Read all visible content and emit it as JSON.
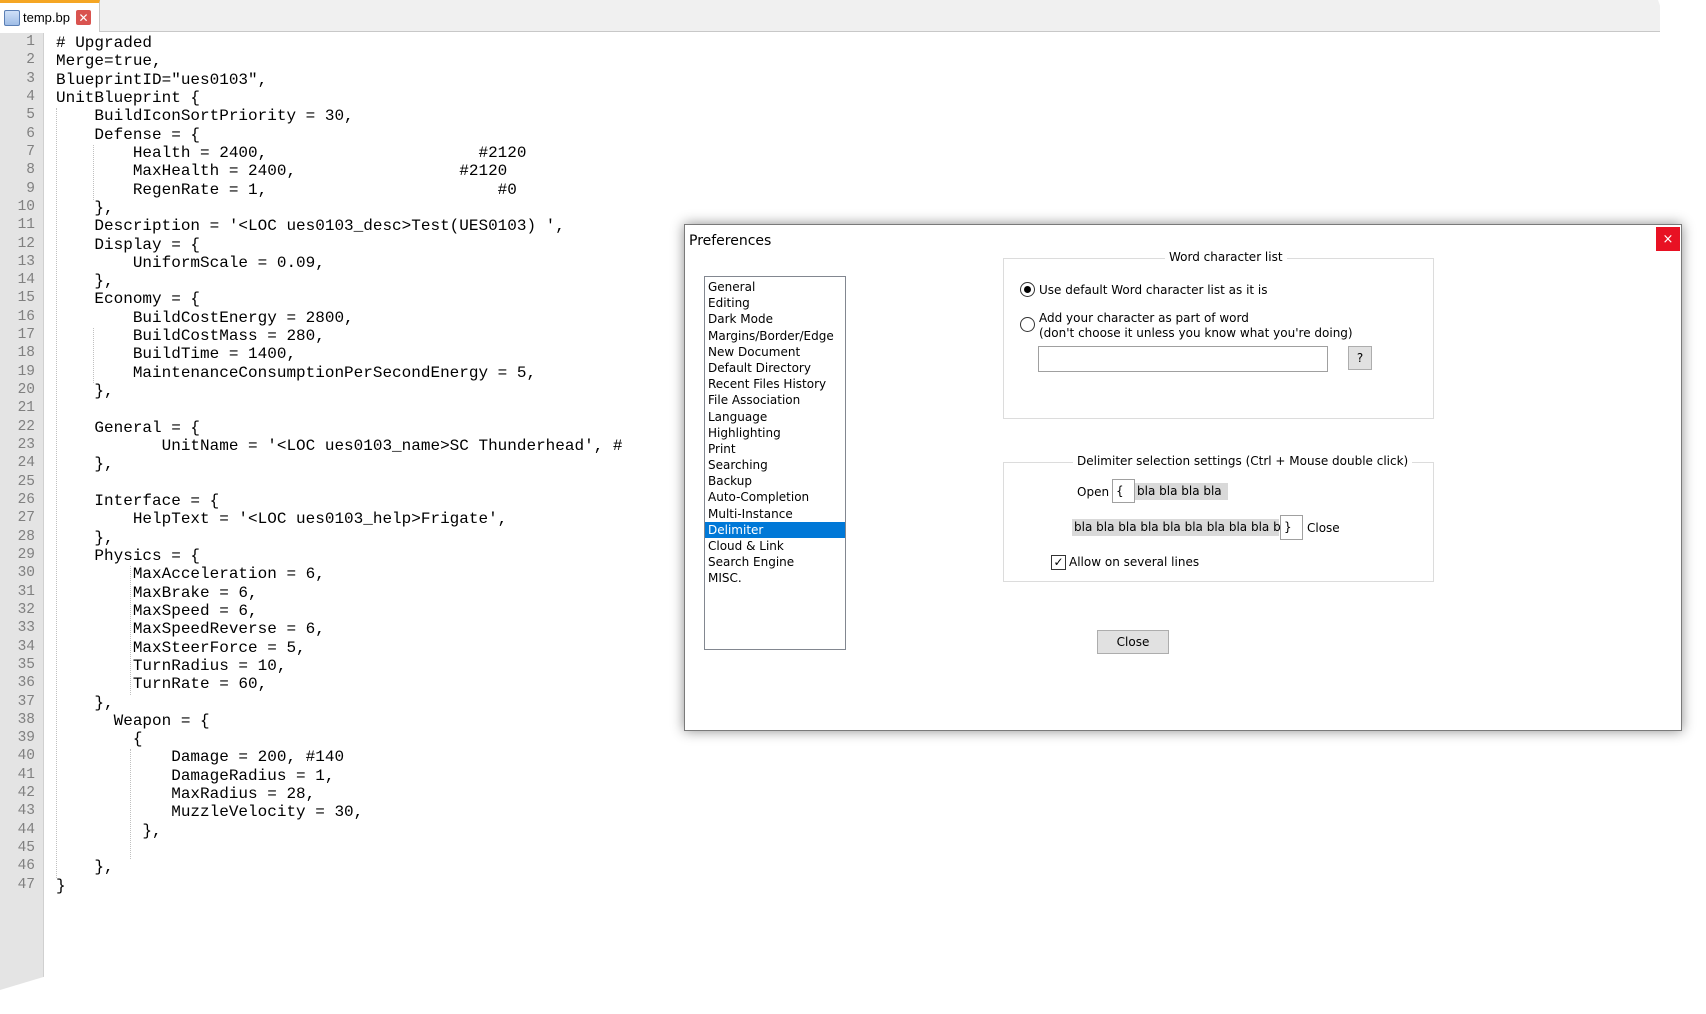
{
  "editor": {
    "tab_title": "temp.bp",
    "line_numbers": [
      "1",
      "2",
      "3",
      "4",
      "5",
      "6",
      "7",
      "8",
      "9",
      "10",
      "11",
      "12",
      "13",
      "14",
      "15",
      "16",
      "17",
      "18",
      "19",
      "20",
      "21",
      "22",
      "23",
      "24",
      "25",
      "26",
      "27",
      "28",
      "29",
      "30",
      "31",
      "32",
      "33",
      "34",
      "35",
      "36",
      "37",
      "38",
      "39",
      "40",
      "41",
      "42",
      "43",
      "44",
      "45",
      "46",
      "47"
    ],
    "lines": [
      "# Upgraded",
      "Merge=true,",
      "BlueprintID=\"ues0103\",",
      "UnitBlueprint {",
      "    BuildIconSortPriority = 30,",
      "    Defense = {",
      "        Health = 2400,                      #2120",
      "        MaxHealth = 2400,                 #2120",
      "        RegenRate = 1,                        #0",
      "    },",
      "    Description = '<LOC ues0103_desc>Test(UES0103) ',",
      "    Display = {",
      "        UniformScale = 0.09,",
      "    },",
      "    Economy = {",
      "        BuildCostEnergy = 2800,",
      "        BuildCostMass = 280,",
      "        BuildTime = 1400,",
      "        MaintenanceConsumptionPerSecondEnergy = 5,",
      "    },",
      "",
      "    General = {",
      "           UnitName = '<LOC ues0103_name>SC Thunderhead', #",
      "    },",
      "",
      "    Interface = {",
      "        HelpText = '<LOC ues0103_help>Frigate',",
      "    },",
      "    Physics = {",
      "        MaxAcceleration = 6,",
      "        MaxBrake = 6,",
      "        MaxSpeed = 6,",
      "        MaxSpeedReverse = 6,",
      "        MaxSteerForce = 5,",
      "        TurnRadius = 10,",
      "        TurnRate = 60,",
      "    },",
      "      Weapon = {",
      "        {",
      "            Damage = 200, #140",
      "            DamageRadius = 1,",
      "            MaxRadius = 28,",
      "            MuzzleVelocity = 30,",
      "         },",
      "",
      "    },",
      "}"
    ]
  },
  "dialog": {
    "title": "Preferences",
    "close_icon": "×",
    "categories": [
      "General",
      "Editing",
      "Dark Mode",
      "Margins/Border/Edge",
      "New Document",
      "Default Directory",
      "Recent Files History",
      "File Association",
      "Language",
      "Highlighting",
      "Print",
      "Searching",
      "Backup",
      "Auto-Completion",
      "Multi-Instance",
      "Delimiter",
      "Cloud & Link",
      "Search Engine",
      "MISC."
    ],
    "selected_category": "Delimiter",
    "word_group": {
      "title": "Word character list",
      "option_default": "Use default Word character list as it is",
      "option_custom_line1": "Add your character as part of word",
      "option_custom_line2": "(don't choose it unless you know what you're doing)",
      "custom_value": "",
      "help_button": "?"
    },
    "delimiter_group": {
      "title": "Delimiter selection settings (Ctrl + Mouse double click)",
      "open_label": "Open",
      "open_value": "{",
      "open_sample": "bla bla bla bla",
      "close_sample": "bla bla bla bla bla bla bla bla bla bla",
      "close_value": "}",
      "close_label": "Close",
      "multiline_label": "Allow on several lines",
      "multiline_checked": "✓"
    },
    "close_button": "Close"
  },
  "colors": {
    "selection": "#0078d7",
    "tab_accent": "#f5a623",
    "close_red": "#e81123"
  }
}
